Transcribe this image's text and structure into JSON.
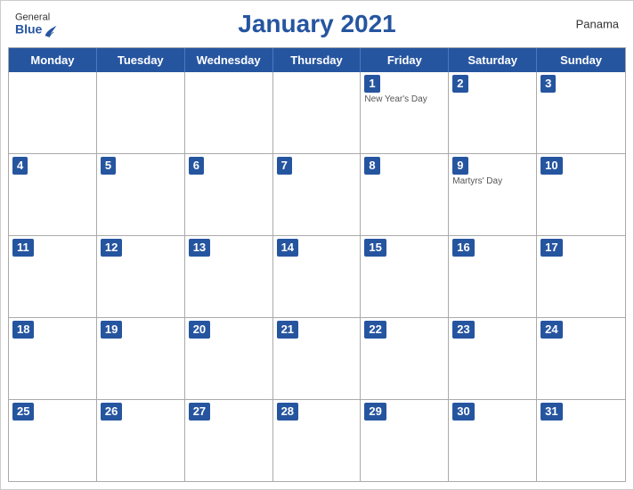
{
  "header": {
    "title": "January 2021",
    "country": "Panama",
    "logo": {
      "general": "General",
      "blue": "Blue"
    }
  },
  "days": [
    "Monday",
    "Tuesday",
    "Wednesday",
    "Thursday",
    "Friday",
    "Saturday",
    "Sunday"
  ],
  "weeks": [
    [
      {
        "date": "",
        "holiday": ""
      },
      {
        "date": "",
        "holiday": ""
      },
      {
        "date": "",
        "holiday": ""
      },
      {
        "date": "",
        "holiday": ""
      },
      {
        "date": "1",
        "holiday": "New Year's Day"
      },
      {
        "date": "2",
        "holiday": ""
      },
      {
        "date": "3",
        "holiday": ""
      }
    ],
    [
      {
        "date": "4",
        "holiday": ""
      },
      {
        "date": "5",
        "holiday": ""
      },
      {
        "date": "6",
        "holiday": ""
      },
      {
        "date": "7",
        "holiday": ""
      },
      {
        "date": "8",
        "holiday": ""
      },
      {
        "date": "9",
        "holiday": "Martyrs' Day"
      },
      {
        "date": "10",
        "holiday": ""
      }
    ],
    [
      {
        "date": "11",
        "holiday": ""
      },
      {
        "date": "12",
        "holiday": ""
      },
      {
        "date": "13",
        "holiday": ""
      },
      {
        "date": "14",
        "holiday": ""
      },
      {
        "date": "15",
        "holiday": ""
      },
      {
        "date": "16",
        "holiday": ""
      },
      {
        "date": "17",
        "holiday": ""
      }
    ],
    [
      {
        "date": "18",
        "holiday": ""
      },
      {
        "date": "19",
        "holiday": ""
      },
      {
        "date": "20",
        "holiday": ""
      },
      {
        "date": "21",
        "holiday": ""
      },
      {
        "date": "22",
        "holiday": ""
      },
      {
        "date": "23",
        "holiday": ""
      },
      {
        "date": "24",
        "holiday": ""
      }
    ],
    [
      {
        "date": "25",
        "holiday": ""
      },
      {
        "date": "26",
        "holiday": ""
      },
      {
        "date": "27",
        "holiday": ""
      },
      {
        "date": "28",
        "holiday": ""
      },
      {
        "date": "29",
        "holiday": ""
      },
      {
        "date": "30",
        "holiday": ""
      },
      {
        "date": "31",
        "holiday": ""
      }
    ]
  ]
}
